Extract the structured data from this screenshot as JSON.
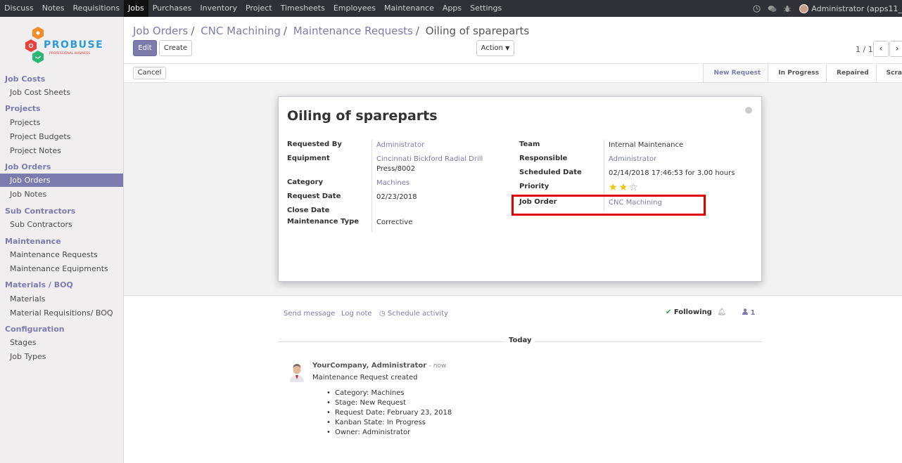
{
  "topbar": {
    "menus": [
      "Discuss",
      "Notes",
      "Requisitions",
      "Jobs",
      "Purchases",
      "Inventory",
      "Project",
      "Timesheets",
      "Employees",
      "Maintenance",
      "Apps",
      "Settings"
    ],
    "active": "Jobs",
    "user": "Administrator (apps11_"
  },
  "sidebar": {
    "logo_text": "PROBUSE",
    "logo_sub": "PROFESSIONAL BUSINESS",
    "sections": [
      {
        "title": "Job Costs",
        "items": [
          "Job Cost Sheets"
        ]
      },
      {
        "title": "Projects",
        "items": [
          "Projects",
          "Project Budgets",
          "Project Notes"
        ]
      },
      {
        "title": "Job Orders",
        "items": [
          "Job Orders",
          "Job Notes"
        ]
      },
      {
        "title": "Sub Contractors",
        "items": [
          "Sub Contractors"
        ]
      },
      {
        "title": "Maintenance",
        "items": [
          "Maintenance Requests",
          "Maintenance Equipments"
        ]
      },
      {
        "title": "Materials / BOQ",
        "items": [
          "Materials",
          "Material Requisitions/ BOQ"
        ]
      },
      {
        "title": "Configuration",
        "items": [
          "Stages",
          "Job Types"
        ]
      }
    ],
    "active_item": "Job Orders"
  },
  "breadcrumb": {
    "items": [
      "Job Orders",
      "CNC Machining",
      "Maintenance Requests"
    ],
    "current": "Oiling of spareparts"
  },
  "buttons": {
    "edit": "Edit",
    "create": "Create",
    "action": "Action",
    "cancel": "Cancel"
  },
  "pager": {
    "text": "1 / 1"
  },
  "stages": [
    "New Request",
    "In Progress",
    "Repaired",
    "Scra"
  ],
  "current_stage": "New Request",
  "record": {
    "title": "Oiling of spareparts",
    "left": {
      "requested_by_label": "Requested By",
      "requested_by": "Administrator",
      "equipment_label": "Equipment",
      "equipment_line1": "Cincinnati Bickford Radial Drill",
      "equipment_line2": "Press/8002",
      "category_label": "Category",
      "category": "Machines",
      "request_date_label": "Request Date",
      "request_date": "02/23/2018",
      "close_date_label": "Close Date",
      "maintenance_type_label": "Maintenance Type",
      "maintenance_type": "Corrective"
    },
    "right": {
      "team_label": "Team",
      "team": "Internal Maintenance",
      "responsible_label": "Responsible",
      "responsible": "Administrator",
      "scheduled_date_label": "Scheduled Date",
      "scheduled_date": "02/14/2018 17:46:53",
      "for_word": "for",
      "duration": "3.00",
      "hours_word": "hours",
      "priority_label": "Priority",
      "priority": 2,
      "priority_max": 3,
      "job_order_label": "Job Order",
      "job_order": "CNC Machining"
    }
  },
  "chatter": {
    "send_message": "Send message",
    "log_note": "Log note",
    "schedule_activity": "Schedule activity",
    "following": "Following",
    "followers_count": "1",
    "today": "Today",
    "message": {
      "author": "YourCompany, Administrator",
      "time": "- now",
      "body": "Maintenance Request created",
      "tracking": [
        "Category: Machines",
        "Stage: New Request",
        "Request Date: February 23, 2018",
        "Kanban State: In Progress",
        "Owner: Administrator"
      ]
    }
  },
  "colors": {
    "accent": "#7c7bad",
    "highlight_box": "#e00000",
    "topbar": "#2f3136"
  }
}
